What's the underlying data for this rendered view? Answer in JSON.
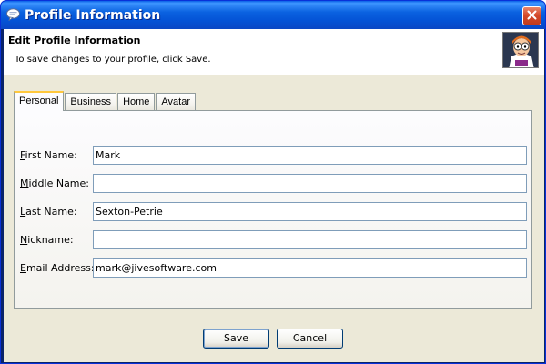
{
  "window": {
    "title": "Profile Information",
    "icon": "chat-bubble-icon",
    "close_icon": "close-icon"
  },
  "header": {
    "title": "Edit Profile Information",
    "description": "To save changes to your profile, click Save.",
    "avatar": "cartoon-avatar"
  },
  "tabs": [
    {
      "label": "Personal",
      "active": true
    },
    {
      "label": "Business",
      "active": false
    },
    {
      "label": "Home",
      "active": false
    },
    {
      "label": "Avatar",
      "active": false
    }
  ],
  "form": {
    "first_name": {
      "mnemonic": "F",
      "label_rest": "irst Name:",
      "value": "Mark"
    },
    "middle_name": {
      "mnemonic": "M",
      "label_rest": "iddle Name:",
      "value": ""
    },
    "last_name": {
      "mnemonic": "L",
      "label_rest": "ast Name:",
      "value": "Sexton-Petrie"
    },
    "nickname": {
      "mnemonic": "N",
      "label_rest": "ickname:",
      "value": ""
    },
    "email": {
      "mnemonic": "E",
      "label_rest": "mail Address:",
      "value": "mark@jivesoftware.com"
    }
  },
  "buttons": {
    "save": "Save",
    "cancel": "Cancel"
  },
  "colors": {
    "titlebar": "#0453d6",
    "client_bg": "#ece9d8",
    "tab_highlight": "#ffc83c",
    "field_border": "#7f9db9"
  }
}
